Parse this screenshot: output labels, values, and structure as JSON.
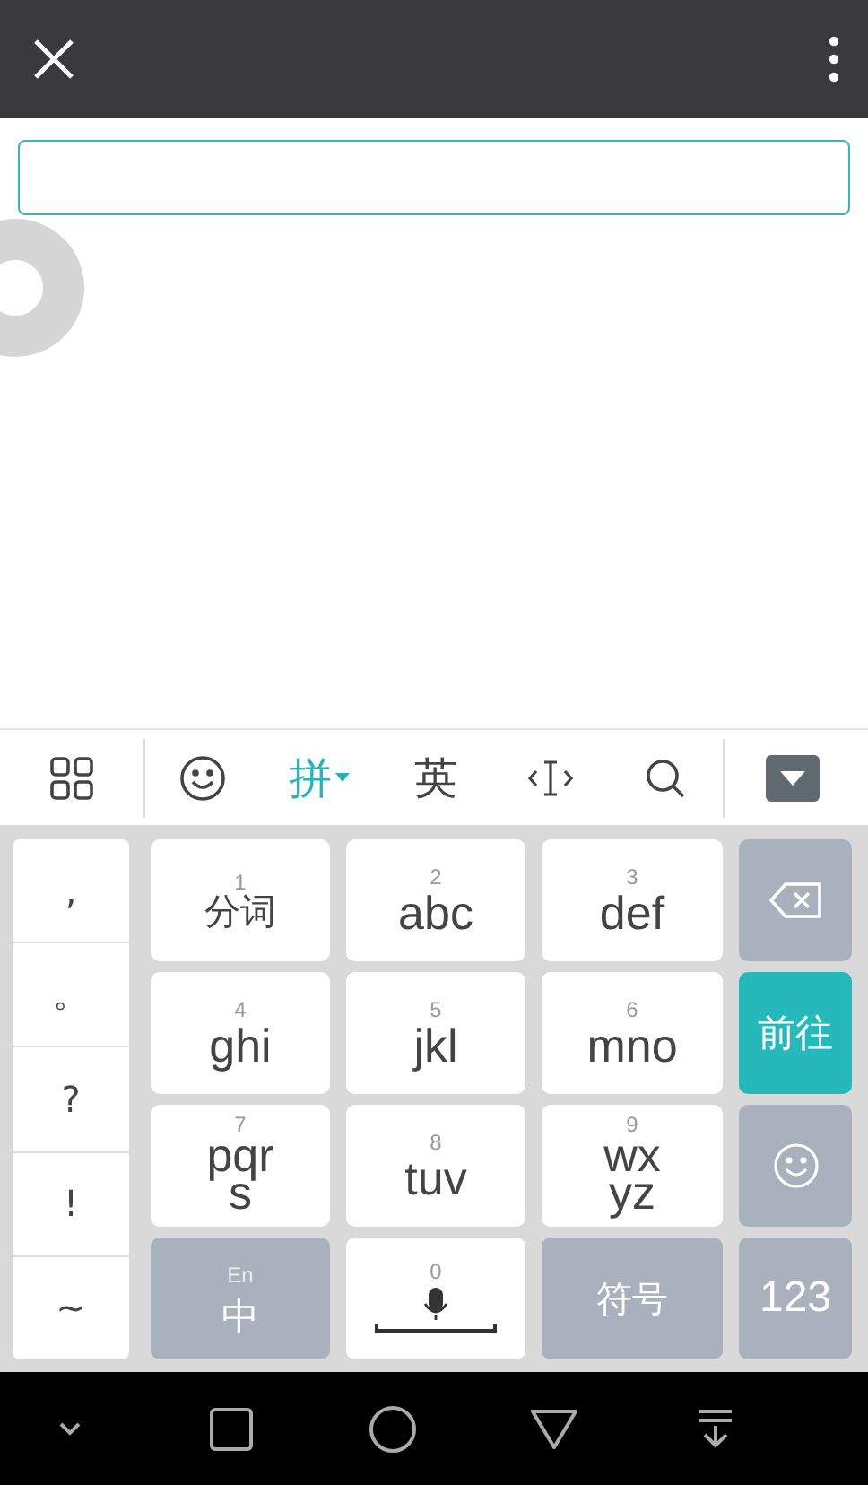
{
  "toolbar": [
    {
      "kind": "grid",
      "selected": false
    },
    {
      "kind": "emoji",
      "selected": false
    },
    {
      "kind": "text",
      "label": "拼",
      "selected": true
    },
    {
      "kind": "text",
      "label": "英",
      "selected": false
    },
    {
      "kind": "cursor",
      "selected": false
    },
    {
      "kind": "search",
      "selected": false
    },
    {
      "kind": "hide",
      "selected": false
    }
  ],
  "punctuation": [
    ",",
    "。",
    "?",
    "!",
    "~"
  ],
  "keys": [
    {
      "kind": "letters",
      "digit": "1",
      "label": "分词"
    },
    {
      "kind": "letters",
      "digit": "2",
      "label": "abc"
    },
    {
      "kind": "letters",
      "digit": "3",
      "label": "def"
    },
    {
      "kind": "backspace"
    },
    {
      "kind": "letters",
      "digit": "4",
      "label": "ghi"
    },
    {
      "kind": "letters",
      "digit": "5",
      "label": "jkl"
    },
    {
      "kind": "letters",
      "digit": "6",
      "label": "mno"
    },
    {
      "kind": "enter",
      "label": "前往"
    },
    {
      "kind": "letters",
      "digit": "7",
      "label": "pqrs"
    },
    {
      "kind": "letters",
      "digit": "8",
      "label": "tuv"
    },
    {
      "kind": "letters",
      "digit": "9",
      "label": "wxyz"
    },
    {
      "kind": "emoji"
    },
    {
      "kind": "lang",
      "hint": "En",
      "label": "中"
    },
    {
      "kind": "space",
      "digit": "0"
    },
    {
      "kind": "function",
      "label": "符号"
    },
    {
      "kind": "function",
      "label": "123"
    }
  ]
}
